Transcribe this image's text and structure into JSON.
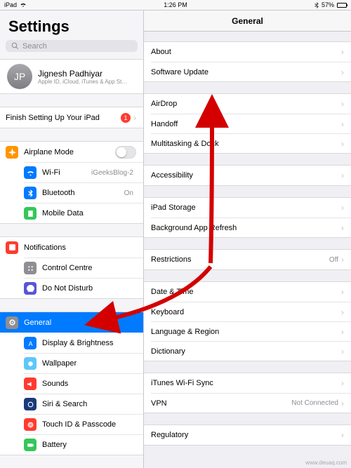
{
  "statusbar": {
    "carrier": "iPad",
    "wifi": "●",
    "time": "1:26 PM",
    "bt": "✱",
    "battery_pct": "57%"
  },
  "sidebar": {
    "title": "Settings",
    "search_placeholder": "Search",
    "profile": {
      "initials": "JP",
      "name": "Jignesh Padhiyar",
      "sub": "Apple ID, iCloud, iTunes & App St…"
    },
    "finish_setup": {
      "label": "Finish Setting Up Your iPad",
      "badge": "1"
    },
    "connectivity": [
      {
        "icon": "airplane",
        "label": "Airplane Mode",
        "toggle": true
      },
      {
        "icon": "wifi",
        "label": "Wi-Fi",
        "value": "iGeeksBlog-2"
      },
      {
        "icon": "bluetooth",
        "label": "Bluetooth",
        "value": "On"
      },
      {
        "icon": "mobile",
        "label": "Mobile Data"
      }
    ],
    "notif": [
      {
        "icon": "notif",
        "label": "Notifications"
      },
      {
        "icon": "control",
        "label": "Control Centre"
      },
      {
        "icon": "dnd",
        "label": "Do Not Disturb"
      }
    ],
    "general_group": [
      {
        "icon": "general",
        "label": "General",
        "selected": true
      },
      {
        "icon": "display",
        "label": "Display & Brightness"
      },
      {
        "icon": "wallpaper",
        "label": "Wallpaper"
      },
      {
        "icon": "sounds",
        "label": "Sounds"
      },
      {
        "icon": "siri",
        "label": "Siri & Search"
      },
      {
        "icon": "touchid",
        "label": "Touch ID & Passcode"
      },
      {
        "icon": "battery",
        "label": "Battery"
      }
    ]
  },
  "detail": {
    "title": "General",
    "groups": [
      [
        {
          "label": "About"
        },
        {
          "label": "Software Update"
        }
      ],
      [
        {
          "label": "AirDrop"
        },
        {
          "label": "Handoff"
        },
        {
          "label": "Multitasking & Dock"
        }
      ],
      [
        {
          "label": "Accessibility"
        }
      ],
      [
        {
          "label": "iPad Storage"
        },
        {
          "label": "Background App Refresh"
        }
      ],
      [
        {
          "label": "Restrictions",
          "value": "Off"
        }
      ],
      [
        {
          "label": "Date & Time"
        },
        {
          "label": "Keyboard"
        },
        {
          "label": "Language & Region"
        },
        {
          "label": "Dictionary"
        }
      ],
      [
        {
          "label": "iTunes Wi-Fi Sync"
        },
        {
          "label": "VPN",
          "value": "Not Connected"
        }
      ],
      [
        {
          "label": "Regulatory"
        }
      ]
    ]
  },
  "watermark": "www.deuaq.com",
  "icon_colors": {
    "airplane": "ic-orange",
    "wifi": "ic-blue",
    "bluetooth": "ic-blue",
    "mobile": "ic-green",
    "notif": "ic-red",
    "control": "ic-gray",
    "dnd": "ic-purple",
    "general": "ic-gray",
    "display": "ic-blue",
    "wallpaper": "ic-teal",
    "sounds": "ic-red",
    "siri": "ic-darkblue",
    "touchid": "ic-red",
    "battery": "ic-green"
  }
}
